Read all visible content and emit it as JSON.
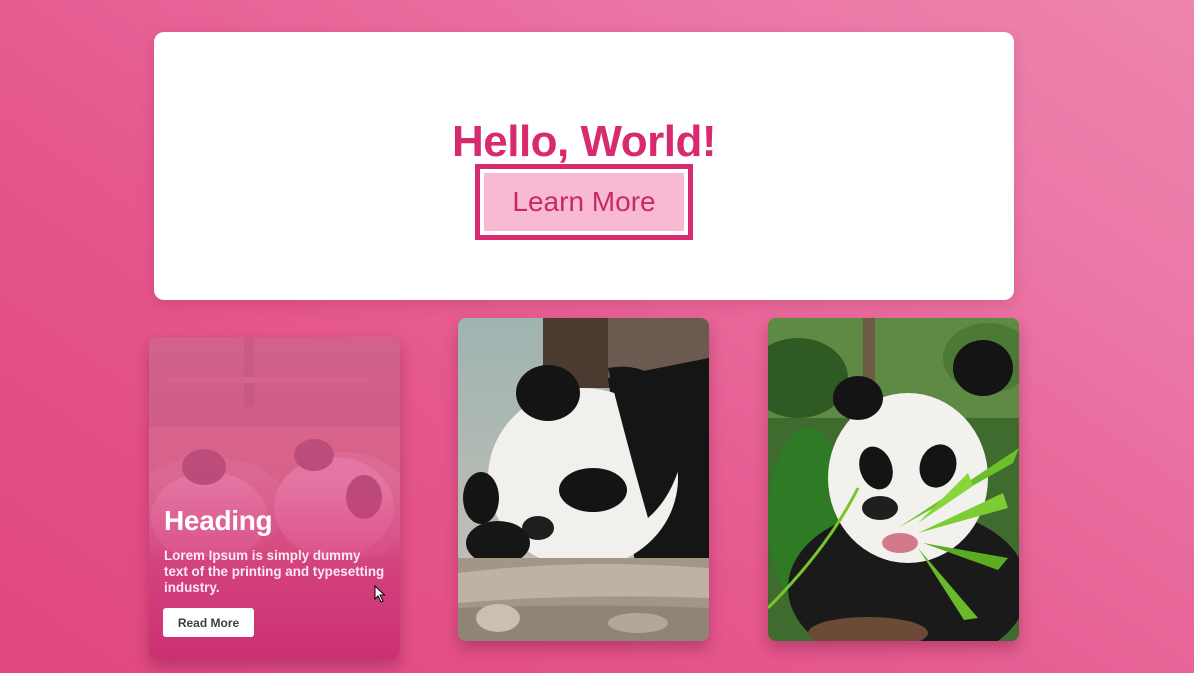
{
  "hero": {
    "title": "Hello, World!",
    "button_label": "Learn More"
  },
  "cards": [
    {
      "heading": "Heading",
      "description": "Lorem Ipsum is simply dummy text of the printing and typesetting industry.",
      "button_label": "Read More",
      "image": "panda-photo"
    },
    {
      "image": "sleeping-panda-photo"
    },
    {
      "image": "panda-eating-bamboo-photo"
    }
  ],
  "colors": {
    "accent": "#d82a6e",
    "button_fill": "#f8b9d3",
    "background_start": "#e0467f",
    "background_end": "#ee85ad"
  }
}
